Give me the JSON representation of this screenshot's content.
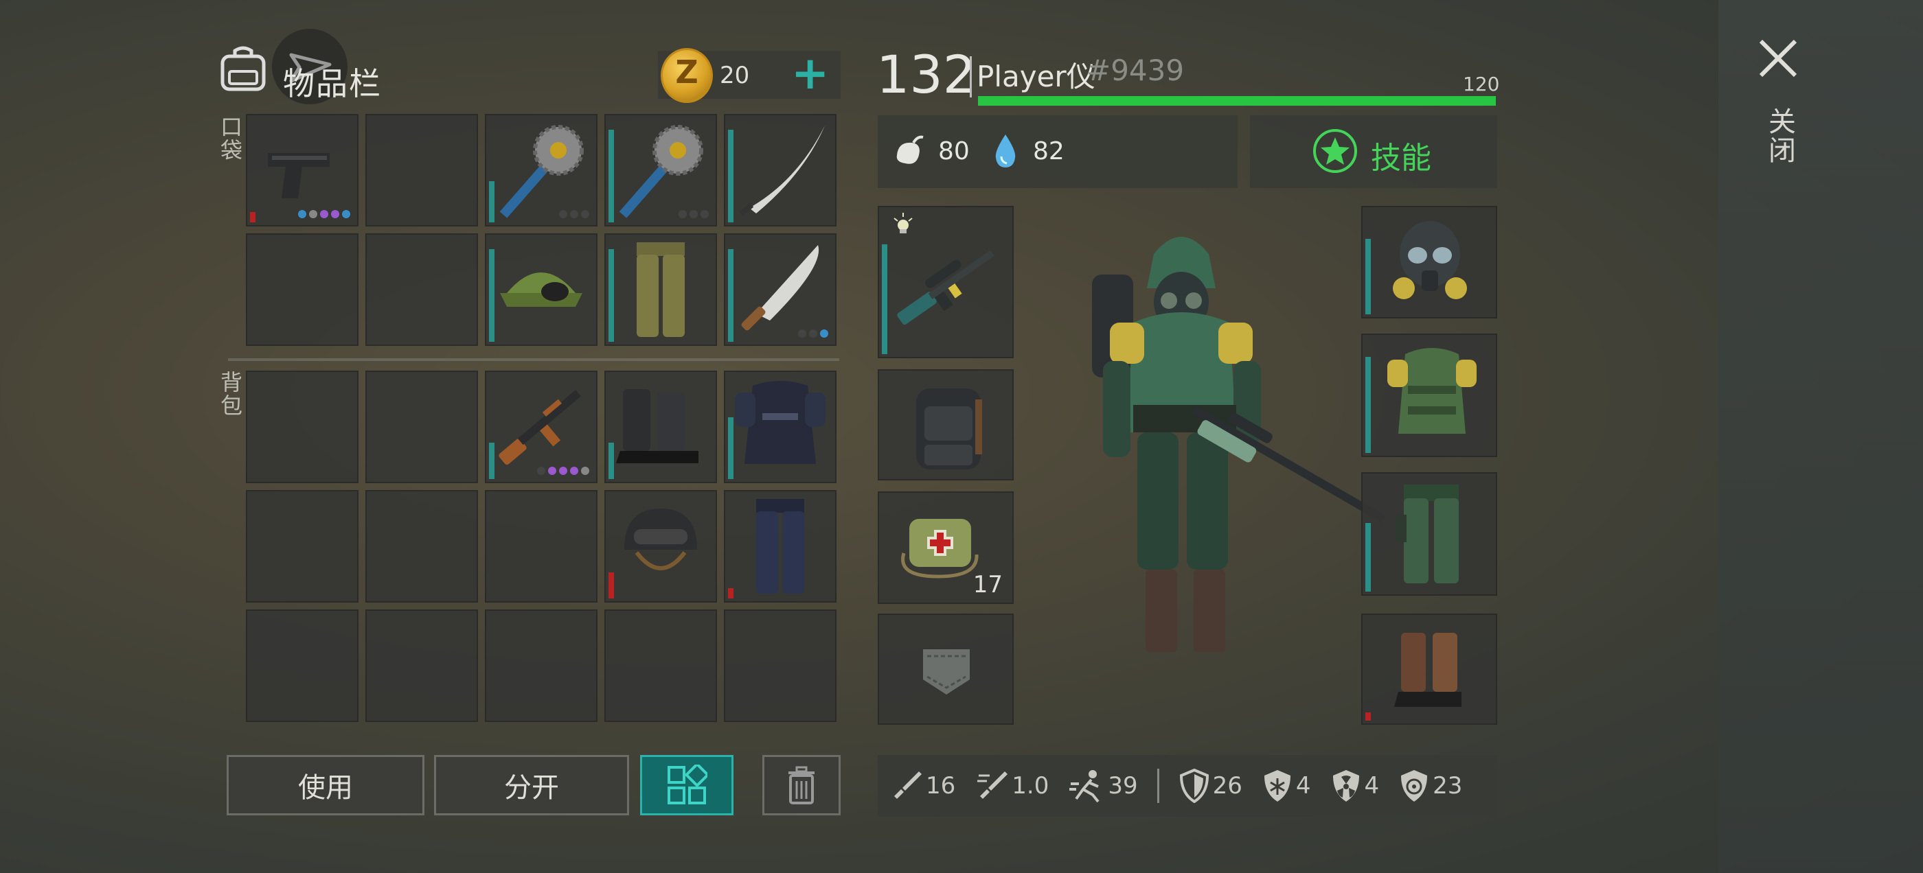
{
  "header": {
    "title": "物品栏",
    "currency": {
      "icon": "coin-icon",
      "symbol": "Z",
      "amount": "20"
    }
  },
  "sections": {
    "pockets_label": "口袋",
    "backpack_label": "背包"
  },
  "inventory": {
    "pockets": [
      {
        "item": "pistol",
        "durability": 0.1,
        "durability_color": "red",
        "dots": [
          "#3a8ec8",
          "#888",
          "#9b59d0",
          "#9b59d0",
          "#3a8ec8"
        ]
      },
      {
        "item": ""
      },
      {
        "item": "saw-mace",
        "durability": 0.4,
        "dots": [
          "#444",
          "#444",
          "#444"
        ]
      },
      {
        "item": "saw-mace",
        "durability": 0.9,
        "dots": [
          "#444",
          "#444",
          "#444"
        ]
      },
      {
        "item": "katana",
        "durability": 0.9
      },
      {
        "item": ""
      },
      {
        "item": ""
      },
      {
        "item": "cap-with-goggles",
        "durability": 0.9
      },
      {
        "item": "camo-pants",
        "durability": 0.9
      },
      {
        "item": "machete",
        "durability": 0.9,
        "dots": [
          "#444",
          "#444",
          "#3a8ec8"
        ]
      }
    ],
    "backpack": [
      {
        "item": ""
      },
      {
        "item": ""
      },
      {
        "item": "ak-rifle",
        "durability": 0.35,
        "dots": [
          "#444",
          "#9b59d0",
          "#9b59d0",
          "#9b59d0",
          "#888"
        ]
      },
      {
        "item": "combat-boots",
        "durability": 0.35
      },
      {
        "item": "police-vest",
        "durability": 0.6
      },
      {
        "item": ""
      },
      {
        "item": ""
      },
      {
        "item": ""
      },
      {
        "item": "helmet",
        "durability": 0.25,
        "durability_color": "red"
      },
      {
        "item": "police-pants",
        "durability": 0.1,
        "durability_color": "red"
      },
      {
        "item": ""
      },
      {
        "item": ""
      },
      {
        "item": ""
      },
      {
        "item": ""
      },
      {
        "item": ""
      }
    ]
  },
  "buttons": {
    "use": "使用",
    "split": "分开",
    "sort_icon": "grid-icon",
    "trash_icon": "trash-icon"
  },
  "player": {
    "level": "132",
    "name": "Player仪",
    "tag": "#9439",
    "xp_value": "120",
    "xp_fraction": 1.0,
    "hunger": "80",
    "thirst": "82",
    "skills_label": "技能"
  },
  "equipment": {
    "left": [
      {
        "item": "sniper-rifle",
        "badge": "light-icon"
      },
      {
        "item": "tactical-backpack"
      },
      {
        "item": "medkit-bag",
        "count": "17"
      },
      {
        "item": "pocket-placeholder"
      }
    ],
    "right": [
      {
        "item": "gas-mask"
      },
      {
        "item": "military-vest"
      },
      {
        "item": "green-pants"
      },
      {
        "item": "brown-boots",
        "durability_color": "red"
      }
    ]
  },
  "stats": {
    "damage": "16",
    "attack_speed": "1.0",
    "speed": "39",
    "armor": "26",
    "cold": "4",
    "radiation": "4",
    "bio": "23"
  },
  "close_label": "关闭",
  "colors": {
    "accent": "#2cb1a5",
    "xp": "#28c542",
    "skill": "#44d45a",
    "low": "#b82222"
  }
}
